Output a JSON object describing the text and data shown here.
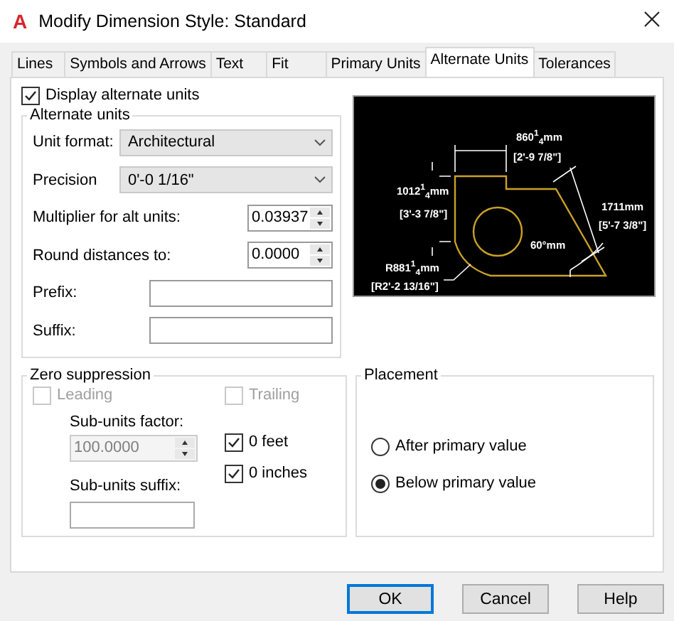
{
  "window": {
    "logo": "A",
    "title": "Modify Dimension Style: Standard"
  },
  "tabs": [
    {
      "label": "Lines",
      "selected": false
    },
    {
      "label": "Symbols and Arrows",
      "selected": false
    },
    {
      "label": "Text",
      "selected": false
    },
    {
      "label": "Fit",
      "selected": false
    },
    {
      "label": "Primary Units",
      "selected": false
    },
    {
      "label": "Alternate Units",
      "selected": true
    },
    {
      "label": "Tolerances",
      "selected": false
    }
  ],
  "display_alternate_units": {
    "label": "Display alternate units",
    "checked": true
  },
  "alternate_units": {
    "title": "Alternate units",
    "fields": [
      {
        "kind": "dropdown",
        "label": "Unit format:",
        "value": "Architectural"
      },
      {
        "kind": "dropdown",
        "label": "Precision",
        "value": "0'-0 1/16\""
      },
      {
        "kind": "spinner",
        "label": "Multiplier for alt units:",
        "value": "0.03937"
      },
      {
        "kind": "spinner",
        "label": "Round distances  to:",
        "value": "0.0000"
      },
      {
        "kind": "text",
        "label": "Prefix:"
      },
      {
        "kind": "text",
        "label": "Suffix:"
      }
    ]
  },
  "preview": {
    "labels": [
      "860$^{1}$$_{4}$mm",
      "[2'-9 7/8\"]",
      "1012$^{1}$$_{4}$mm",
      "[3'-3 7/8\"]",
      "1711mm",
      "[5'-7 3/8\"]",
      "60°mm",
      "R881$^{1}$$_{4}$mm",
      "[R2'-2 13/16\"]"
    ]
  },
  "zero_suppression": {
    "title": "Zero suppression",
    "leading": {
      "label": "Leading",
      "checked": false,
      "disabled": true
    },
    "trailing": {
      "label": "Trailing",
      "checked": false,
      "disabled": true
    },
    "sub_units_factor": {
      "label": "Sub-units factor:",
      "value": "100.0000",
      "disabled": true
    },
    "sub_units_suffix": {
      "label": "Sub-units suffix:"
    },
    "zero_feet": {
      "label": "0 feet",
      "checked": true,
      "disabled": false
    },
    "zero_inches": {
      "label": "0 inches",
      "checked": true,
      "disabled": false
    }
  },
  "placement": {
    "title": "Placement",
    "options": [
      {
        "label": "After primary value",
        "selected": false
      },
      {
        "label": "Below primary value",
        "selected": true
      }
    ]
  },
  "buttons": [
    {
      "label": "OK",
      "default": true
    },
    {
      "label": "Cancel",
      "default": false
    },
    {
      "label": "Help",
      "default": false
    }
  ]
}
